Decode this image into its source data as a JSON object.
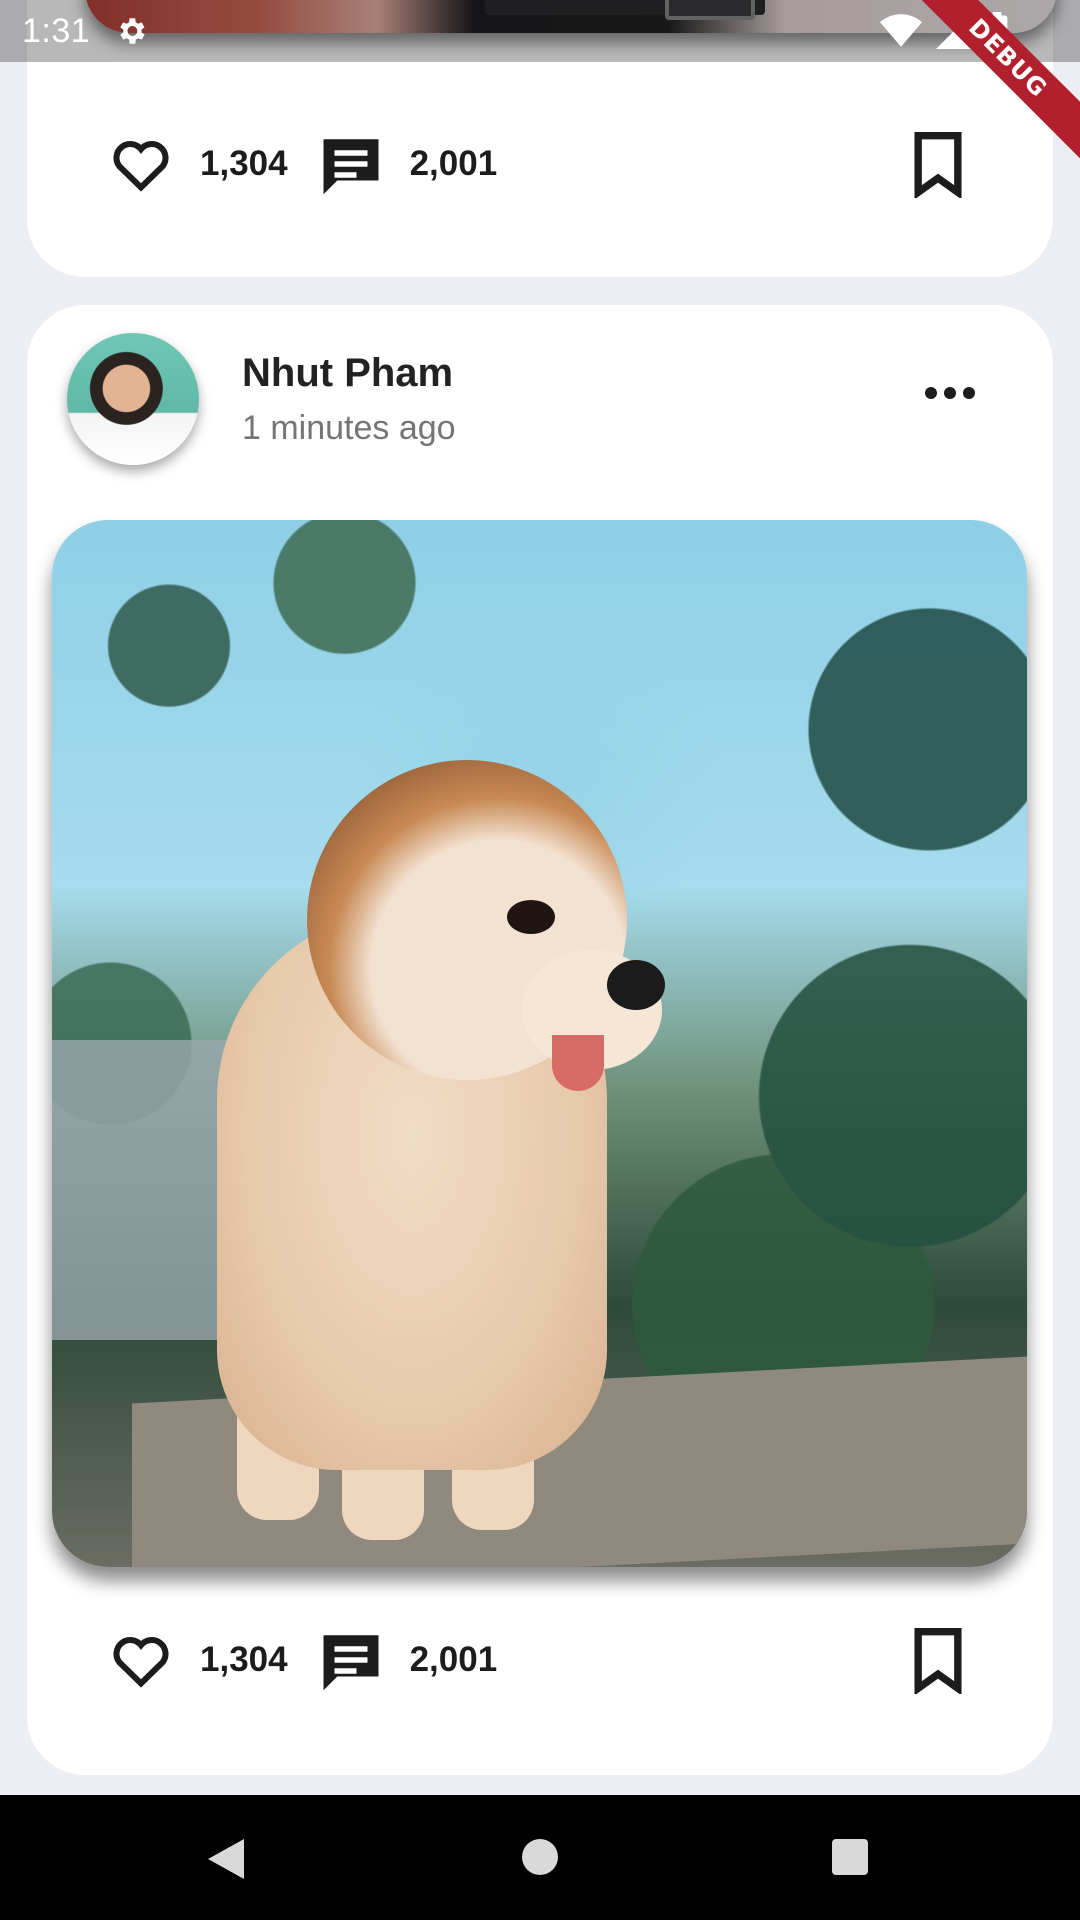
{
  "status_bar": {
    "time": "1:31",
    "icons": [
      "gear-icon",
      "wifi-icon",
      "signal-icon",
      "battery-icon"
    ]
  },
  "debug_banner": "DEBUG",
  "top_post": {
    "likes": "1,304",
    "comments": "2,001"
  },
  "post": {
    "author": "Nhut Pham",
    "time_ago": "1 minutes ago",
    "likes": "1,304",
    "comments": "2,001"
  },
  "nav_bar": {
    "buttons": [
      "back-icon",
      "home-icon",
      "recents-icon"
    ]
  },
  "colors": {
    "background": "#edeef3",
    "card": "#ffffff",
    "text_primary": "#1c1c1c",
    "text_secondary": "#757575",
    "debug_red": "#b3202d",
    "nav_bar": "#000000"
  }
}
